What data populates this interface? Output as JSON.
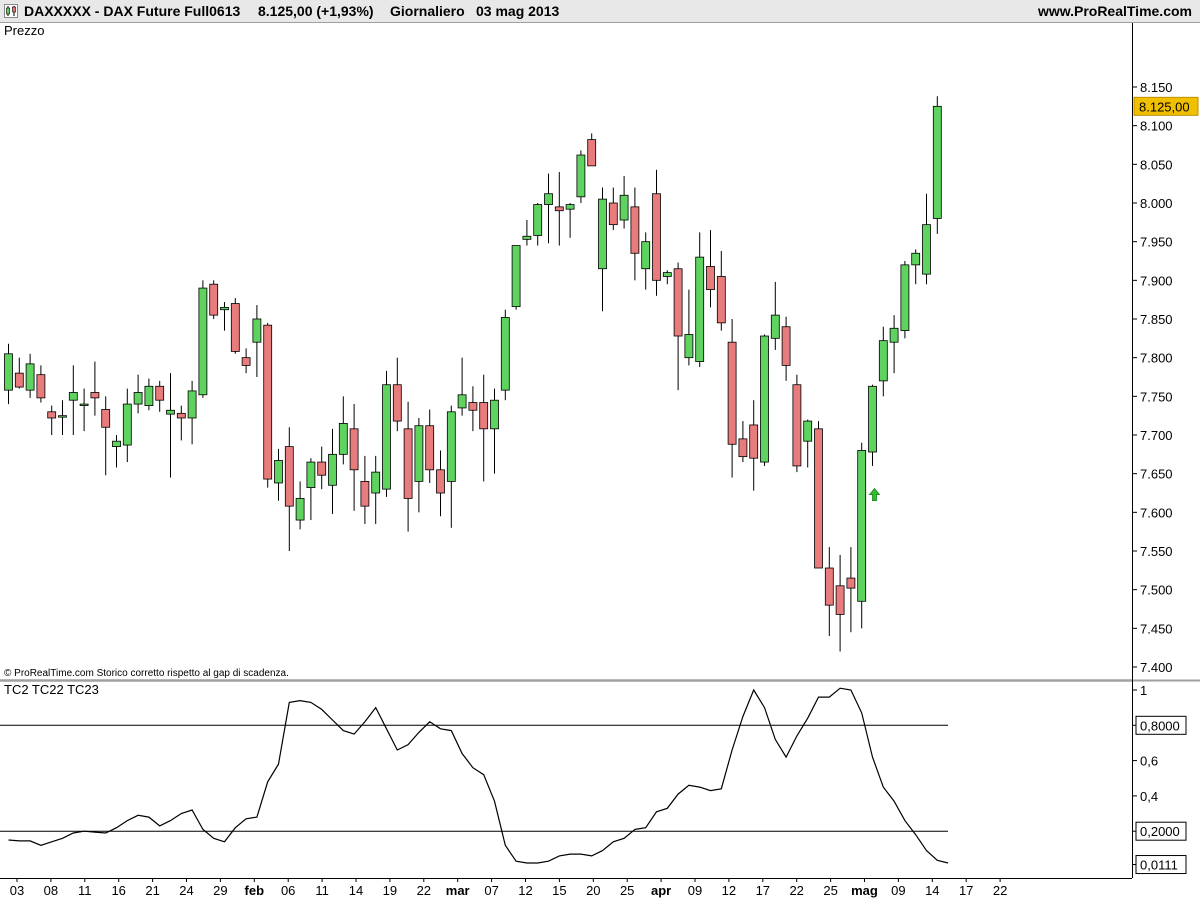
{
  "header": {
    "symbol": "DAXXXXX - DAX Future Full0613",
    "price": "8.125,00 (+1,93%)",
    "period": "Giornaliero",
    "date": "03 mag 2013",
    "brand": "www.ProRealTime.com",
    "icon": "candlestick-chart-icon"
  },
  "colors": {
    "up": "#5fd35f",
    "down": "#e87b7b",
    "price_label_bg": "#f0c000",
    "signal_arrow": "#33bb33"
  },
  "chart_data": [
    {
      "type": "candlestick",
      "title": "Prezzo",
      "footnote": "© ProRealTime.com  Storico corretto rispetto al gap di scadenza.",
      "ylim": [
        7380,
        8190
      ],
      "yticks": [
        7400,
        7450,
        7500,
        7550,
        7600,
        7650,
        7700,
        7750,
        7800,
        7850,
        7900,
        7950,
        8000,
        8050,
        8100,
        8150
      ],
      "ytick_labels": [
        "7.400",
        "7.450",
        "7.500",
        "7.550",
        "7.600",
        "7.650",
        "7.700",
        "7.750",
        "7.800",
        "7.850",
        "7.900",
        "7.950",
        "8.000",
        "8.050",
        "8.100",
        "8.150"
      ],
      "last_price_label": "8.125,00",
      "last_price": 8125,
      "x_tick_labels": [
        "03",
        "08",
        "11",
        "16",
        "21",
        "24",
        "29",
        "feb",
        "06",
        "11",
        "14",
        "19",
        "22",
        "mar",
        "07",
        "12",
        "15",
        "20",
        "25",
        "apr",
        "09",
        "12",
        "17",
        "22",
        "25",
        "mag",
        "09",
        "14",
        "17",
        "22"
      ],
      "x_tick_bold": [
        "feb",
        "mar",
        "apr",
        "mag"
      ],
      "candles": [
        {
          "o": 7758,
          "h": 7818,
          "l": 7740,
          "c": 7805
        },
        {
          "o": 7780,
          "h": 7800,
          "l": 7760,
          "c": 7762
        },
        {
          "o": 7758,
          "h": 7805,
          "l": 7748,
          "c": 7792
        },
        {
          "o": 7778,
          "h": 7790,
          "l": 7742,
          "c": 7748
        },
        {
          "o": 7730,
          "h": 7738,
          "l": 7700,
          "c": 7722
        },
        {
          "o": 7725,
          "h": 7745,
          "l": 7700,
          "c": 7725
        },
        {
          "o": 7745,
          "h": 7790,
          "l": 7700,
          "c": 7755
        },
        {
          "o": 7740,
          "h": 7760,
          "l": 7705,
          "c": 7740
        },
        {
          "o": 7755,
          "h": 7795,
          "l": 7725,
          "c": 7748
        },
        {
          "o": 7733,
          "h": 7750,
          "l": 7648,
          "c": 7710
        },
        {
          "o": 7685,
          "h": 7700,
          "l": 7658,
          "c": 7692
        },
        {
          "o": 7687,
          "h": 7760,
          "l": 7665,
          "c": 7740
        },
        {
          "o": 7740,
          "h": 7778,
          "l": 7728,
          "c": 7755
        },
        {
          "o": 7738,
          "h": 7773,
          "l": 7732,
          "c": 7763
        },
        {
          "o": 7763,
          "h": 7770,
          "l": 7730,
          "c": 7745
        },
        {
          "o": 7727,
          "h": 7780,
          "l": 7645,
          "c": 7732
        },
        {
          "o": 7728,
          "h": 7738,
          "l": 7693,
          "c": 7722
        },
        {
          "o": 7722,
          "h": 7770,
          "l": 7688,
          "c": 7757
        },
        {
          "o": 7752,
          "h": 7900,
          "l": 7748,
          "c": 7890
        },
        {
          "o": 7895,
          "h": 7900,
          "l": 7850,
          "c": 7855
        },
        {
          "o": 7862,
          "h": 7872,
          "l": 7835,
          "c": 7865
        },
        {
          "o": 7870,
          "h": 7877,
          "l": 7805,
          "c": 7808
        },
        {
          "o": 7800,
          "h": 7812,
          "l": 7780,
          "c": 7790
        },
        {
          "o": 7820,
          "h": 7868,
          "l": 7775,
          "c": 7850
        },
        {
          "o": 7842,
          "h": 7845,
          "l": 7632,
          "c": 7643
        },
        {
          "o": 7638,
          "h": 7682,
          "l": 7615,
          "c": 7667
        },
        {
          "o": 7685,
          "h": 7710,
          "l": 7550,
          "c": 7608
        },
        {
          "o": 7590,
          "h": 7640,
          "l": 7578,
          "c": 7618
        },
        {
          "o": 7632,
          "h": 7670,
          "l": 7590,
          "c": 7665
        },
        {
          "o": 7665,
          "h": 7685,
          "l": 7630,
          "c": 7648
        },
        {
          "o": 7635,
          "h": 7708,
          "l": 7598,
          "c": 7675
        },
        {
          "o": 7675,
          "h": 7750,
          "l": 7662,
          "c": 7715
        },
        {
          "o": 7708,
          "h": 7740,
          "l": 7602,
          "c": 7655
        },
        {
          "o": 7640,
          "h": 7673,
          "l": 7585,
          "c": 7608
        },
        {
          "o": 7625,
          "h": 7673,
          "l": 7585,
          "c": 7652
        },
        {
          "o": 7630,
          "h": 7783,
          "l": 7620,
          "c": 7765
        },
        {
          "o": 7765,
          "h": 7800,
          "l": 7705,
          "c": 7718
        },
        {
          "o": 7708,
          "h": 7743,
          "l": 7575,
          "c": 7618
        },
        {
          "o": 7640,
          "h": 7722,
          "l": 7600,
          "c": 7712
        },
        {
          "o": 7712,
          "h": 7733,
          "l": 7638,
          "c": 7655
        },
        {
          "o": 7655,
          "h": 7680,
          "l": 7595,
          "c": 7625
        },
        {
          "o": 7640,
          "h": 7738,
          "l": 7580,
          "c": 7730
        },
        {
          "o": 7735,
          "h": 7800,
          "l": 7725,
          "c": 7752
        },
        {
          "o": 7742,
          "h": 7763,
          "l": 7705,
          "c": 7732
        },
        {
          "o": 7742,
          "h": 7778,
          "l": 7640,
          "c": 7708
        },
        {
          "o": 7708,
          "h": 7760,
          "l": 7650,
          "c": 7745
        },
        {
          "o": 7758,
          "h": 7862,
          "l": 7745,
          "c": 7852
        },
        {
          "o": 7866,
          "h": 7945,
          "l": 7862,
          "c": 7945
        },
        {
          "o": 7953,
          "h": 7978,
          "l": 7945,
          "c": 7957
        },
        {
          "o": 7958,
          "h": 8000,
          "l": 7945,
          "c": 7998
        },
        {
          "o": 7998,
          "h": 8038,
          "l": 7948,
          "c": 8012
        },
        {
          "o": 7995,
          "h": 8040,
          "l": 7945,
          "c": 7990
        },
        {
          "o": 7992,
          "h": 8000,
          "l": 7955,
          "c": 7998
        },
        {
          "o": 8008,
          "h": 8068,
          "l": 8000,
          "c": 8062
        },
        {
          "o": 8082,
          "h": 8090,
          "l": 8050,
          "c": 8048
        },
        {
          "o": 7915,
          "h": 8020,
          "l": 7860,
          "c": 8005
        },
        {
          "o": 8000,
          "h": 8020,
          "l": 7965,
          "c": 7972
        },
        {
          "o": 7978,
          "h": 8035,
          "l": 7967,
          "c": 8010
        },
        {
          "o": 7995,
          "h": 8020,
          "l": 7900,
          "c": 7935
        },
        {
          "o": 7915,
          "h": 7962,
          "l": 7888,
          "c": 7950
        },
        {
          "o": 8012,
          "h": 8043,
          "l": 7880,
          "c": 7900
        },
        {
          "o": 7905,
          "h": 7913,
          "l": 7895,
          "c": 7910
        },
        {
          "o": 7915,
          "h": 7923,
          "l": 7758,
          "c": 7828
        },
        {
          "o": 7800,
          "h": 7888,
          "l": 7790,
          "c": 7830
        },
        {
          "o": 7795,
          "h": 7962,
          "l": 7788,
          "c": 7930
        },
        {
          "o": 7918,
          "h": 7965,
          "l": 7865,
          "c": 7888
        },
        {
          "o": 7905,
          "h": 7938,
          "l": 7835,
          "c": 7845
        },
        {
          "o": 7820,
          "h": 7850,
          "l": 7645,
          "c": 7688
        },
        {
          "o": 7695,
          "h": 7718,
          "l": 7665,
          "c": 7672
        },
        {
          "o": 7713,
          "h": 7745,
          "l": 7628,
          "c": 7670
        },
        {
          "o": 7665,
          "h": 7830,
          "l": 7660,
          "c": 7828
        },
        {
          "o": 7825,
          "h": 7898,
          "l": 7810,
          "c": 7855
        },
        {
          "o": 7840,
          "h": 7853,
          "l": 7770,
          "c": 7790
        },
        {
          "o": 7765,
          "h": 7778,
          "l": 7652,
          "c": 7660
        },
        {
          "o": 7692,
          "h": 7720,
          "l": 7658,
          "c": 7718
        },
        {
          "o": 7708,
          "h": 7718,
          "l": 7530,
          "c": 7528
        },
        {
          "o": 7528,
          "h": 7555,
          "l": 7440,
          "c": 7480
        },
        {
          "o": 7505,
          "h": 7545,
          "l": 7420,
          "c": 7468
        },
        {
          "o": 7515,
          "h": 7555,
          "l": 7445,
          "c": 7502
        },
        {
          "o": 7485,
          "h": 7690,
          "l": 7450,
          "c": 7680
        },
        {
          "o": 7678,
          "h": 7765,
          "l": 7660,
          "c": 7763
        },
        {
          "o": 7770,
          "h": 7840,
          "l": 7750,
          "c": 7822
        },
        {
          "o": 7820,
          "h": 7855,
          "l": 7780,
          "c": 7838
        },
        {
          "o": 7835,
          "h": 7925,
          "l": 7825,
          "c": 7920
        },
        {
          "o": 7920,
          "h": 7940,
          "l": 7895,
          "c": 7935
        },
        {
          "o": 7908,
          "h": 8012,
          "l": 7895,
          "c": 7972
        },
        {
          "o": 7980,
          "h": 8138,
          "l": 7960,
          "c": 8125
        }
      ],
      "signals": [
        {
          "candle_index": 80,
          "type": "up-arrow",
          "price": 7623
        }
      ]
    },
    {
      "type": "line",
      "title": "TC2 TC22 TC23",
      "ylim": [
        -0.01,
        1.05
      ],
      "ytick_labels": [
        "1",
        "0,8000",
        "0,6",
        "0,4",
        "0,2000",
        "0,0111"
      ],
      "ytick_values": [
        1,
        0.8,
        0.6,
        0.4,
        0.2,
        0.0111
      ],
      "ytick_boxed": [
        false,
        true,
        false,
        false,
        true,
        true
      ],
      "hlines": [
        0.8,
        0.2
      ],
      "values": [
        0.15,
        0.145,
        0.145,
        0.12,
        0.14,
        0.16,
        0.19,
        0.2,
        0.195,
        0.19,
        0.22,
        0.26,
        0.29,
        0.28,
        0.23,
        0.26,
        0.3,
        0.32,
        0.21,
        0.16,
        0.14,
        0.22,
        0.27,
        0.28,
        0.48,
        0.58,
        0.93,
        0.94,
        0.93,
        0.89,
        0.83,
        0.77,
        0.75,
        0.82,
        0.9,
        0.78,
        0.66,
        0.69,
        0.76,
        0.82,
        0.78,
        0.77,
        0.64,
        0.56,
        0.52,
        0.37,
        0.12,
        0.03,
        0.02,
        0.02,
        0.03,
        0.06,
        0.07,
        0.07,
        0.06,
        0.09,
        0.14,
        0.16,
        0.21,
        0.22,
        0.31,
        0.33,
        0.41,
        0.46,
        0.45,
        0.43,
        0.44,
        0.66,
        0.85,
        1.0,
        0.9,
        0.72,
        0.62,
        0.74,
        0.84,
        0.96,
        0.96,
        1.01,
        1.0,
        0.87,
        0.62,
        0.45,
        0.37,
        0.26,
        0.18,
        0.09,
        0.035,
        0.02
      ]
    }
  ]
}
